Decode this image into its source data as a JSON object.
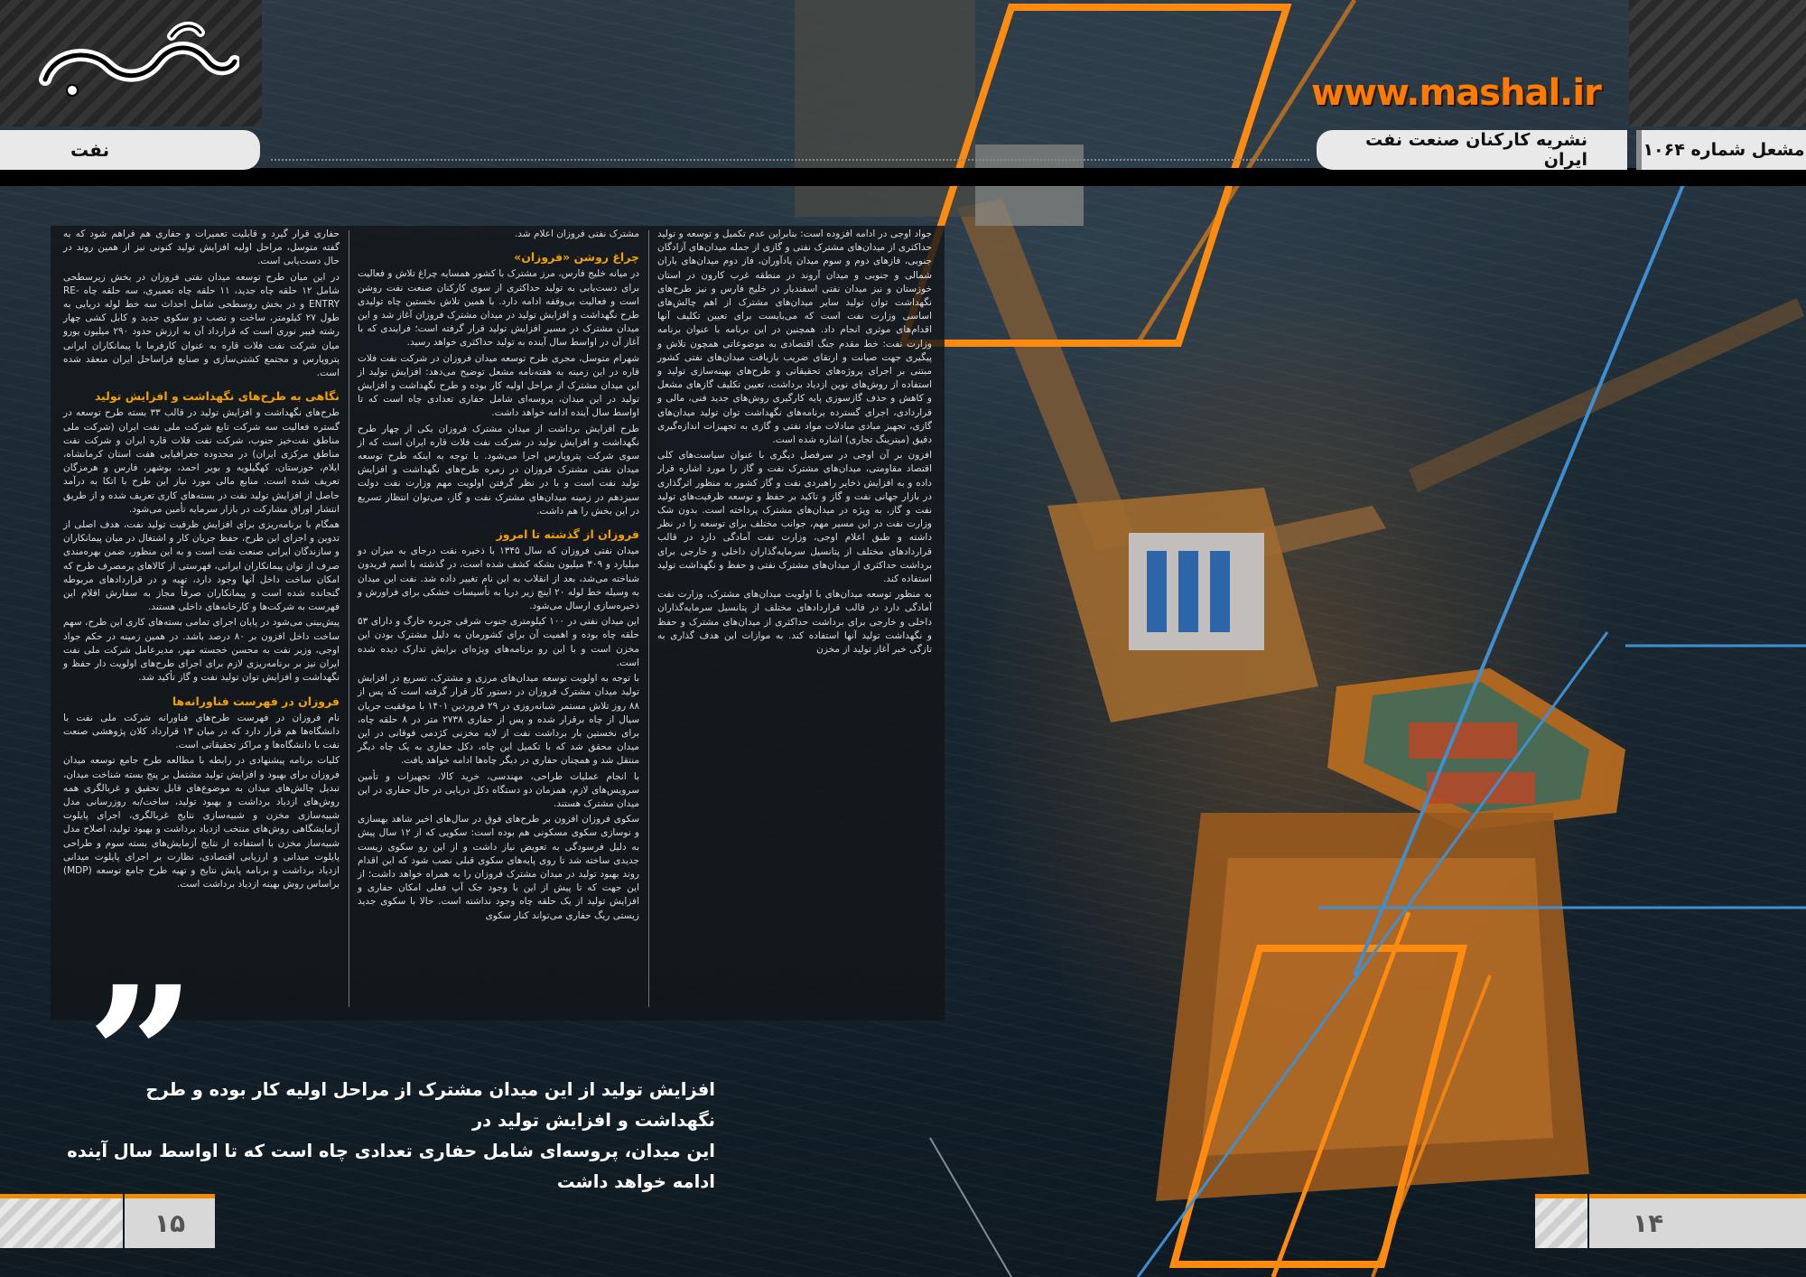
{
  "header": {
    "site_url": "www.mashal.ir",
    "section": "نفت",
    "publication": "نشریه کارکنان صنعت نفت ایران",
    "issue": "مشعل شماره ۱۰۶۴"
  },
  "colors": {
    "accent_orange": "#f08a00",
    "heading_yellow": "#f2a100",
    "line_blue": "#3f8fd0"
  },
  "columns": {
    "a": {
      "p1": "جواد اوجی در ادامه افزوده است: بنابراین عدم تکمیل و توسعه و تولید حداکثری از میدان‌های مشترک نفتی و گازی از جمله میدان‌های آزادگان جنوبی، فازهای دوم و سوم میدان یادآوران، فاز دوم میدان‌های یاران شمالی و جنوبی و میدان آروند در منطقه غرب کارون در استان خوزستان و نیز میدان نفتی اسفندیار در خلیج فارس و نیز طرح‌های نگهداشت توان تولید سایر میدان‌های مشترک از اهم چالش‌های اساسی وزارت نفت است که می‌بایست برای تعیین تکلیف آنها اقدام‌های موثری انجام داد. همچنین در این برنامه با عنوان برنامه وزارت نفت: خط مقدم جنگ اقتصادی به موضوعاتی همچون تلاش و پیگیری جهت صیانت و ارتقای ضریب بازیافت میدان‌های نفتی کشور مبتنی بر اجرای پروژه‌های تحقیقاتی و طرح‌های بهینه‌سازی تولید و استفاده از روش‌های نوین ازدیاد برداشت، تعیین تکلیف گازهای مشعل و کاهش و حذف گازسوزی پایه کارگیری روش‌های جدید فنی، مالی و قراردادی، اجرای گسترده برنامه‌های نگهداشت توان تولید میدان‌های گازی، تجهیز مبادی مبادلات مواد نفتی و گازی به تجهیزات اندازه‌گیری دقیق (میترینگ تجاری) اشاره شده است.",
      "p2": "افزون بر آن اوجی در سرفصل دیگری با عنوان سیاست‌های کلی اقتصاد مقاومتی، میدان‌های مشترک نفت و گاز را مورد اشاره قرار داده و به افزایش ذخایر راهبردی نفت و گاز کشور به منظور اثرگذاری در بازار جهانی نفت و گاز و تاکید بر حفظ و توسعه ظرفیت‌های تولید نفت و گاز، به ویژه در میدان‌های مشترک پرداخته است. بدون شک وزارت نفت در این مسیر مهم، جوانب مختلف برای توسعه را در نظر داشته و طبق اعلام اوجی، وزارت نفت آمادگی دارد در قالب قراردادهای مختلف از پتانسیل سرمایه‌گذاران داخلی و خارجی برای برداشت حداکثری از میدان‌های مشترک نفتی و حفظ و نگهداشت تولید استفاده کند.",
      "p3": "به منظور توسعه میدان‌های با اولویت میدان‌های مشترک، وزارت نفت آمادگی دارد در قالب قراردادهای مختلف از پتانسیل سرمایه‌گذاران داخلی و خارجی برای برداشت حداکثری از میدان‌های مشترک و حفظ و نگهداشت تولید آنها استفاده کند. به موازات این هدف گذاری به تازگی خبر آغاز تولید از مخزن"
    },
    "b": {
      "p1": "مشترک نفتی فروزان اعلام شد.",
      "h1": "چراغ روشن «فروزان»",
      "p2": "در میانه خلیج فارس، مرز مشترک با کشور همسایه چراغ تلاش و فعالیت برای دست‌یابی به تولید حداکثری از سوی کارکنان صنعت نفت روشن است و فعالیت بی‌وقفه ادامه دارد. با همین تلاش نخستین چاه تولیدی طرح نگهداشت و افزایش تولید در میدان مشترک فروزان آغاز شد و این میدان مشترک در مسیر افزایش تولید قرار گرفته است؛ فرایندی که با آغاز آن در اواسط سال آینده به تولید حداکثری خواهد رسید.",
      "p3": "شهرام متوسل، مجری طرح توسعه میدان فروزان در شرکت نفت فلات قاره در این زمینه به هفته‌نامه مشعل توضیح می‌دهد: افزایش تولید از این میدان مشترک از مراحل اولیه کار بوده و طرح نگهداشت و افزایش تولید در این میدان، پروسه‌ای شامل حفاری تعدادی چاه است که تا اواسط سال آینده ادامه خواهد داشت.",
      "p4": "طرح افزایش برداشت از میدان مشترک فروزان یکی از چهار طرح نگهداشت و افزایش تولید در شرکت نفت فلات قاره ایران است که از سوی شرکت پتروپارس اجرا می‌شود. با توجه به اینکه طرح توسعه میدان نفتی مشترک فروزان در زمره طرح‌های نگهداشت و افزایش تولید نفت است و با در نظر گرفتن اولویت مهم وزارت نفت دولت سیزدهم در زمینه میدان‌های مشترک نفت و گاز، می‌توان انتظار تسریع در این بخش را هم داشت.",
      "h2": "فروزان از گذشته تا امروز",
      "p5": "میدان نفتی فروزان که سال ۱۳۴۵ با ذخیره نفت درجای به میزان دو میلیارد و ۳۰۹ میلیون بشکه کشف شده است، در گذشته با اسم فریدون شناخته می‌شد، بعد از انقلاب به این نام تغییر داده شد. نفت این میدان به وسیله خط لوله ۲۰ اینچ زیر دریا به تأسیسات خشکی برای فراورش و ذخیره‌سازی ارسال می‌شود.",
      "p6": "این میدان نفتی در ۱۰۰ کیلومتری جنوب شرقی جزیره خارگ و دارای ۵۳ حلقه چاه بوده و اهمیت آن برای کشورمان به دلیل مشترک بودن این مخزن است و با این رو برنامه‌های ویژه‌ای برایش تدارک دیده شده است.",
      "p7": "با توجه به اولویت توسعه میدان‌های مرزی و مشترک، تسریع در افزایش تولید میدان مشترک فروزان در دستور کار قرار گرفته است که پس از ۸۸ روز تلاش مستمر شبانه‌روزی در ۲۹ فروردین ۱۴۰۱ با موفقیت جریان سیال از چاه برقرار شده و پس از حفاری ۲۷۳۸ متر در ۸ حلقه چاه، برای نخستین بار برداشت نفت از لایه مخزنی کژدمی فوقانی در این میدان محقق شد که با تکمیل این چاه، دکل حفاری به یک چاه دیگر منتقل شد و همچنان حفاری در دیگر چاه‌ها ادامه خواهد یافت.",
      "p8": "با انجام عملیات طراحی، مهندسی، خرید کالا، تجهیزات و تأمین سرویس‌های لازم، همزمان دو دستگاه دکل دریایی در حال حفاری در این میدان مشترک هستند.",
      "p9": "سکوی فروزان افزون بر طرح‌های فوق در سال‌های اخیر شاهد بهسازی و نوسازی سکوی مسکونی هم بوده است: سکویی که از ۱۲ سال پیش به دلیل فرسودگی به تعویض نیاز داشت و از این رو سکوی زیست جدیدی ساخته شد تا روی پایه‌های سکوی قبلی نصب شود که این اقدام روند بهبود تولید در میدان مشترک فروزان را به همراه خواهد داشت؛ از این جهت که تا پیش از این با وجود جک آپ فعلی امکان حفاری و افزایش تولید از یک حلقه چاه وجود نداشته است. حالا با سکوی جدید زیستی ریگ حفاری می‌تواند کنار سکوی"
    },
    "c": {
      "p1": "حفاری قرار گیرد و قابلیت تعمیرات و حفاری هم فراهم شود که به گفته متوسل، مراحل اولیه افزایش تولید کنونی نیز از همین روند در حال دست‌یابی است.",
      "p2": "در این میان طرح توسعه میدان نفتی فروزان در بخش زیرسطحی شامل ۱۲ حلقه چاه جدید، ۱۱ حلقه چاه تعمیری، سه حلقه چاه RE-ENTRY و در بخش روسطحی شامل احداث سه خط لوله دریایی به طول ۲۷ کیلومتر، ساخت و نصب دو سکوی جدید و کابل کشی چهار رشته فیبر نوری است که قرارداد آن به ارزش حدود ۲۹۰ میلیون یورو میان شرکت نفت فلات قاره به عنوان کارفرما با پیمانکاران ایرانی پتروپارس و مجتمع کشتی‌سازی و صنایع فراساحل ایران منعقد شده است.",
      "h1": "نگاهی به طرح‌های نگهداشت و افزایش تولید",
      "p3": "طرح‌های نگهداشت و افزایش تولید در قالب ۳۳ بسته طرح توسعه در گستره فعالیت سه شرکت تابع شرکت ملی نفت ایران (شرکت ملی مناطق نفت‌خیز جنوب، شرکت نفت فلات قاره ایران و شرکت نفت مناطق مرکزی ایران) در محدوده جغرافیایی هفت استان کرمانشاه، ایلام، خوزستان، کهگیلویه و بویر احمد، بوشهر، فارس و هرمزگان تعریف شده است. منابع مالی مورد نیاز این طرح با اتکا به درآمد حاصل از افزایش تولید نفت در بسته‌های کاری تعریف شده و از طریق انتشار اوراق مشارکت در بازار سرمایه تأمین می‌شود.",
      "p4": "همگام با برنامه‌ریزی برای افزایش ظرفیت تولید نفت، هدف اصلی از تدوین و اجرای این طرح، حفظ جریان کار و اشتغال در میان پیمانکاران و سازندگان ایرانی صنعت نفت است و به این منظور، ضمن بهره‌مندی صرف از توان پیمانکاران ایرانی، فهرستی از کالاهای پرمصرف طرح که امکان ساخت داخل آنها وجود دارد، تهیه و در قراردادهای مربوطه گنجانده شده است و پیمانکاران صرفاً مجاز به سفارش اقلام این فهرست به شرکت‌ها و کارخانه‌های داخلی هستند.",
      "p5": "پیش‌بینی می‌شود در پایان اجرای تمامی بسته‌های کاری این طرح، سهم ساخت داخل افزون بر ۸۰ درصد باشد. در همین زمینه در حکم جواد اوجی، وزیر نفت به محسن خجسته مهر، مدیرعامل شرکت ملی نفت ایران نیز بر برنامه‌ریزی لازم برای اجرای طرح‌های اولویت دار حفظ و نگهداشت و افزایش توان تولید نفت و گاز تأکید شد.",
      "h2": "فروزان در فهرست فناورانه‌ها",
      "p6": "نام فروزان در فهرست طرح‌های فناورانه شرکت ملی نفت با دانشگاه‌ها هم قرار دارد که در میان ۱۳ قرارداد کلان پژوهشی صنعت نفت با دانشگاه‌ها و مراکز تحقیقاتی است.",
      "p7": "کلیات برنامه پیشنهادی در رابطه با مطالعه طرح جامع توسعه میدان فروزان برای بهبود و افزایش تولید مشتمل بر پنج بسته شناخت میدان، تبدیل چالش‌های میدان به موضوع‌های قابل تحقیق و غربالگری همه روش‌های ازدیاد برداشت و بهبود تولید، ساخت/به روزرسانی مدل شبیه‌سازی مخزن و شبیه‌سازی نتایج غربالگری، اجرای پایلوت آزمایشگاهی روش‌های منتخب ازدیاد برداشت و بهبود تولید، اصلاح مدل شبیه‌ساز مخزن با استفاده از نتایج آزمایش‌های بسته سوم و طراحی پایلوت میدانی و ارزیابی اقتصادی، نظارت بر اجرای پایلوت میدانی ازدیاد برداشت و برنامه پایش نتایج و تهیه طرح جامع توسعه (MDP) براساس روش بهینه ازدیاد برداشت است."
    }
  },
  "quote": {
    "mark": "”",
    "line1": "افزایش تولید از این میدان مشترک از مراحل اولیه کار بوده و طرح نگهداشت و افزایش تولید در",
    "line2": "این میدان، پروسه‌ای شامل حفاری تعدادی چاه است که تا اواسط سال آینده ادامه خواهد داشت"
  },
  "pages": {
    "left": "۱۵",
    "right": "۱۴"
  }
}
